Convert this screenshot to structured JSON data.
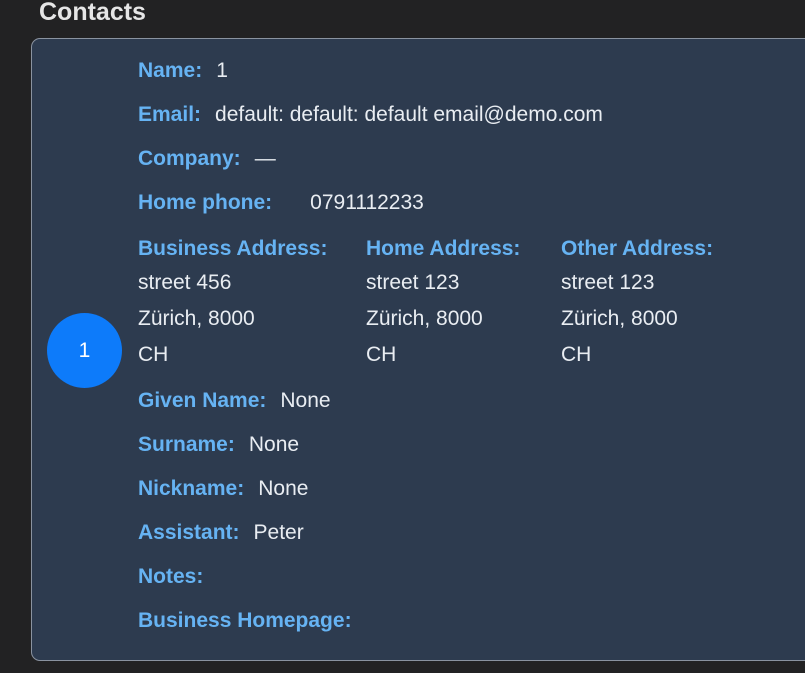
{
  "page": {
    "title": "Contacts"
  },
  "contact": {
    "avatar_initial": "1",
    "name_label": "Name:",
    "name_value": "1",
    "email_label": "Email:",
    "email_value": "default: default: default email@demo.com",
    "company_label": "Company:",
    "company_value": "—",
    "home_phone_label": "Home phone:",
    "home_phone_value": "0791112233",
    "addresses": [
      {
        "label": "Business Address:",
        "street": "street 456",
        "city": "Zürich, 8000",
        "country": "CH"
      },
      {
        "label": "Home Address:",
        "street": "street 123",
        "city": "Zürich, 8000",
        "country": "CH"
      },
      {
        "label": "Other Address:",
        "street": "street 123",
        "city": "Zürich, 8000",
        "country": "CH"
      }
    ],
    "given_name_label": "Given Name:",
    "given_name_value": "None",
    "surname_label": "Surname:",
    "surname_value": "None",
    "nickname_label": "Nickname:",
    "nickname_value": "None",
    "assistant_label": "Assistant:",
    "assistant_value": "Peter",
    "notes_label": "Notes:",
    "notes_value": "",
    "business_homepage_label": "Business Homepage:",
    "business_homepage_value": ""
  },
  "colors": {
    "background": "#222223",
    "card": "#2d3b4f",
    "label": "#66b3f3",
    "value": "#e9edf2",
    "avatar": "#0d7bfa"
  }
}
